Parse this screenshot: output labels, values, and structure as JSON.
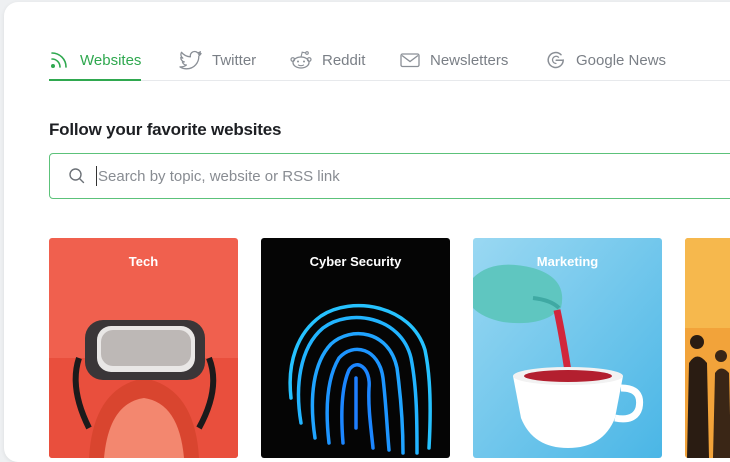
{
  "tabs": [
    {
      "label": "Websites",
      "icon": "rss-icon",
      "active": true
    },
    {
      "label": "Twitter",
      "icon": "twitter-icon",
      "active": false
    },
    {
      "label": "Reddit",
      "icon": "reddit-icon",
      "active": false
    },
    {
      "label": "Newsletters",
      "icon": "mail-icon",
      "active": false
    },
    {
      "label": "Google News",
      "icon": "google-icon",
      "active": false
    }
  ],
  "main": {
    "heading": "Follow your favorite websites",
    "search": {
      "value": "",
      "placeholder": "Search by topic, website or RSS link",
      "icon": "search-icon"
    }
  },
  "cards": [
    {
      "label": "Tech",
      "image": "vr-headset"
    },
    {
      "label": "Cyber Security",
      "image": "fingerprint"
    },
    {
      "label": "Marketing",
      "image": "teapot-pouring"
    },
    {
      "label": "",
      "image": "silhouettes"
    }
  ],
  "colors": {
    "accent": "#2fa84f",
    "tech_bg": "#f0604e",
    "cyber_bg": "#050505",
    "marketing_bg": "#7fcbec",
    "business_bg": "#f2a33a"
  }
}
